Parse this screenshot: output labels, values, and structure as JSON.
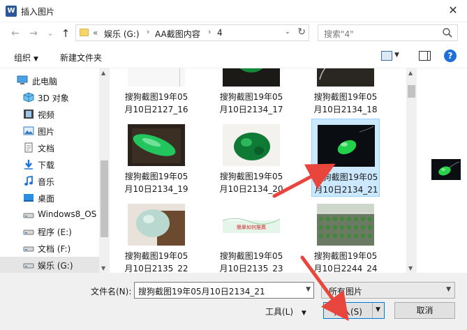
{
  "window": {
    "app_icon_letter": "W",
    "title": "插入图片",
    "close_glyph": "✕"
  },
  "address": {
    "back_glyph": "←",
    "forward_glyph": "→",
    "recent_glyph": "⌄",
    "up_glyph": "↑",
    "overflow": "«",
    "crumbs": [
      "娱乐 (G:)",
      "AA截图内容",
      "4"
    ],
    "sep": "›",
    "dropdown_glyph": "⌄",
    "refresh_glyph": "↻",
    "search_placeholder": "搜索\"4\""
  },
  "toolbar": {
    "organize_label": "组织",
    "caret": "▼",
    "new_folder_label": "新建文件夹",
    "help_label": "?"
  },
  "sidebar": {
    "items": [
      {
        "label": "此电脑",
        "icon": "computer-icon",
        "indent": 0
      },
      {
        "label": "3D 对象",
        "icon": "cube-3d-icon"
      },
      {
        "label": "视频",
        "icon": "film-icon"
      },
      {
        "label": "图片",
        "icon": "pictures-icon"
      },
      {
        "label": "文档",
        "icon": "document-icon"
      },
      {
        "label": "下载",
        "icon": "download-arrow-icon"
      },
      {
        "label": "音乐",
        "icon": "music-note-icon"
      },
      {
        "label": "桌面",
        "icon": "desktop-icon"
      },
      {
        "label": "Windows8_OS",
        "icon": "drive-icon"
      },
      {
        "label": "程序 (E:)",
        "icon": "drive-icon"
      },
      {
        "label": "文档 (F:)",
        "icon": "drive-icon"
      },
      {
        "label": "娱乐 (G:)",
        "icon": "drive-icon",
        "selected": true
      }
    ]
  },
  "files": [
    {
      "line1": "搜狗截图19年05",
      "line2": "月10日2127_16",
      "thumb": "doc-screenshot"
    },
    {
      "line1": "搜狗截图19年05",
      "line2": "月10日2134_17",
      "thumb": "jade-carving-dark"
    },
    {
      "line1": "搜狗截图19年05",
      "line2": "月10日2134_18",
      "thumb": "jade-pendant-chain"
    },
    {
      "line1": "搜狗截图19年05",
      "line2": "月10日2134_19",
      "thumb": "jade-bar"
    },
    {
      "line1": "搜狗截图19年05",
      "line2": "月10日2134_20",
      "thumb": "jade-carving-white"
    },
    {
      "line1": "搜狗截图19年05",
      "line2": "月10日2134_21",
      "thumb": "jade-bean-black",
      "selected": true
    },
    {
      "line1": "搜狗截图19年05",
      "line2": "月10日2135_22",
      "thumb": "jade-disc"
    },
    {
      "line1": "搜狗截图19年05",
      "line2": "月10日2135_23",
      "thumb": "banner-text",
      "banner_text": "簡單如何推薦"
    },
    {
      "line1": "搜狗截图19年05",
      "line2": "月10日2244_24",
      "thumb": "greenhouse"
    }
  ],
  "footer": {
    "filename_label": "文件名(N):",
    "filename_value": "搜狗截图19年05月10日2134_21",
    "filter_value": "所有图片",
    "tools_label": "工具(L)",
    "tools_caret": "▼",
    "insert_label": "插入(S)",
    "insert_caret": "▼",
    "cancel_label": "取消"
  },
  "colors": {
    "accent": "#0078d7",
    "selection_bg": "#cce8ff",
    "annotation_arrow": "#e8453c",
    "jade_green": "#22c55e"
  }
}
